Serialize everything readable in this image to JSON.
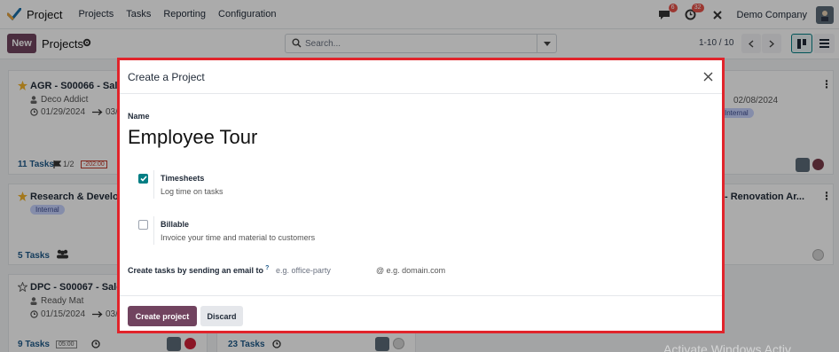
{
  "navbar": {
    "app_name": "Project",
    "menu": [
      "Projects",
      "Tasks",
      "Reporting",
      "Configuration"
    ],
    "messages_badge": "6",
    "activity_badge": "32",
    "company": "Demo Company"
  },
  "control": {
    "new_label": "New",
    "title": "Projects",
    "search_placeholder": "Search...",
    "pager": "1-10 / 10"
  },
  "cards": {
    "c1": {
      "title": "AGR - S00066 - Sale",
      "customer": "Deco Addict",
      "date": "01/29/2024",
      "date_to": "03/",
      "tasks": "11 Tasks",
      "milestones": "1/2",
      "box": "-202:00"
    },
    "c2": {
      "title": "Research & Develop",
      "tag": "Internal",
      "tasks": "5 Tasks"
    },
    "c3": {
      "title": "DPC - S00067 - Sale",
      "customer": "Ready Mat",
      "date": "01/15/2024",
      "date_to": "03/",
      "tasks": "9 Tasks",
      "box": "05:00"
    },
    "c4": {
      "tasks": "23 Tasks"
    },
    "c5": {
      "date_to": "02/08/2024",
      "tag": "Internal"
    },
    "c6": {
      "title": "- Renovation Ar..."
    }
  },
  "modal": {
    "title": "Create a Project",
    "name_label": "Name",
    "name_value": "Employee Tour",
    "options": [
      {
        "title": "Timesheets",
        "desc": "Log time on tasks",
        "checked": true
      },
      {
        "title": "Billable",
        "desc": "Invoice your time and material to customers",
        "checked": false
      }
    ],
    "alias_label": "Create tasks by sending an email to",
    "alias_help": "?",
    "alias_placeholder": "e.g. office-party",
    "domain": "@ e.g. domain.com",
    "create_label": "Create project",
    "discard_label": "Discard"
  },
  "watermark": "Activate Windows  Activ",
  "colors": {
    "brand": "#71435f",
    "checkbox": "#017e84",
    "highlight_border": "#e1242b",
    "badge": "#e8524a"
  }
}
